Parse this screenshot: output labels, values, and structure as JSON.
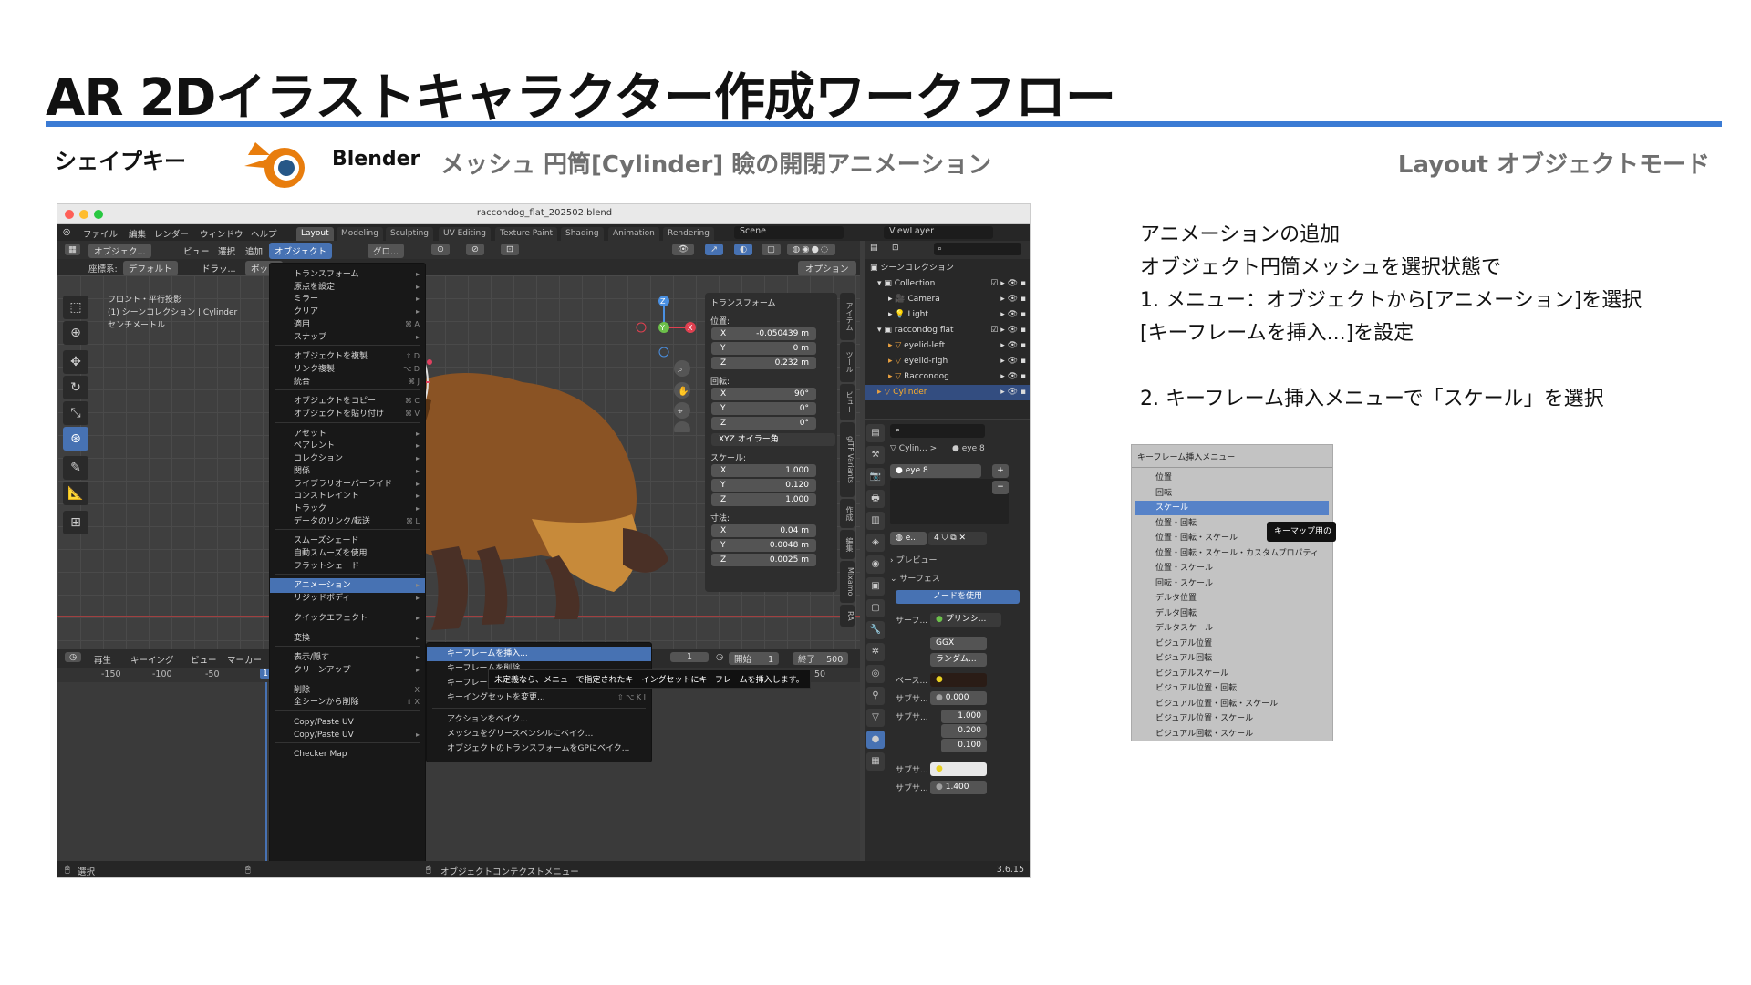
{
  "slide": {
    "title": "AR 2Dイラストキャラクター作成ワークフロー",
    "section": "シェイプキー",
    "app_name": "Blender",
    "subtitle": "メッシュ 円筒[Cylinder] 瞼の開閉アニメーション",
    "mode": "Layout オブジェクトモード",
    "accent_color": "#3b7bd4"
  },
  "instructions": [
    "アニメーションの追加",
    "オブジェクト円筒メッシュを選択状態で",
    "1. メニュー：オブジェクトから[アニメーション]を選択",
    "[キーフレームを挿入...]を設定",
    "",
    "2. キーフレーム挿入メニューで「スケール」を選択"
  ],
  "blender": {
    "file_name": "raccondog_flat_202502.blend",
    "menubar": [
      "ファイル",
      "編集",
      "レンダー",
      "ウィンドウ",
      "ヘルプ"
    ],
    "workspaces": [
      "Layout",
      "Modeling",
      "Sculpting",
      "UV Editing",
      "Texture Paint",
      "Shading",
      "Animation",
      "Rendering"
    ],
    "active_workspace": "Layout",
    "scene": "Scene",
    "view_layer": "ViewLayer",
    "header": {
      "mode": "オブジェク...",
      "view": "ビュー",
      "select": "選択",
      "add": "追加",
      "object": "オブジェクト",
      "transform_orientation": "グロ...",
      "coord_label": "座標系:",
      "coord_value": "デフォルト",
      "drag": "ドラッ...",
      "box": "ボック",
      "options": "オプション"
    },
    "viewport_overlay": [
      "フロント・平行投影",
      "(1) シーンコレクション | Cylinder",
      "センチメートル"
    ],
    "object_menu": [
      {
        "label": "トランスフォーム",
        "sub": true
      },
      {
        "label": "原点を設定",
        "sub": true
      },
      {
        "label": "ミラー",
        "sub": true
      },
      {
        "label": "クリア",
        "sub": true
      },
      {
        "label": "適用",
        "shortcut": "⌘ A"
      },
      {
        "label": "スナップ",
        "sub": true
      },
      {
        "sep": true
      },
      {
        "label": "オブジェクトを複製",
        "shortcut": "⇧ D"
      },
      {
        "label": "リンク複製",
        "shortcut": "⌥ D"
      },
      {
        "label": "統合",
        "shortcut": "⌘ J"
      },
      {
        "sep": true
      },
      {
        "label": "オブジェクトをコピー",
        "shortcut": "⌘ C"
      },
      {
        "label": "オブジェクトを貼り付け",
        "shortcut": "⌘ V"
      },
      {
        "sep": true
      },
      {
        "label": "アセット",
        "sub": true
      },
      {
        "label": "ペアレント",
        "sub": true
      },
      {
        "label": "コレクション",
        "sub": true
      },
      {
        "label": "関係",
        "sub": true
      },
      {
        "label": "ライブラリオーバーライド",
        "sub": true
      },
      {
        "label": "コンストレイント",
        "sub": true
      },
      {
        "label": "トラック",
        "sub": true
      },
      {
        "label": "データのリンク/転送",
        "shortcut": "⌘ L"
      },
      {
        "sep": true
      },
      {
        "label": "スムーズシェード"
      },
      {
        "label": "自動スムーズを使用"
      },
      {
        "label": "フラットシェード"
      },
      {
        "sep": true
      },
      {
        "label": "アニメーション",
        "sub": true,
        "highlight": true
      },
      {
        "label": "リジッドボディ",
        "sub": true
      },
      {
        "sep": true
      },
      {
        "label": "クイックエフェクト",
        "sub": true
      },
      {
        "sep": true
      },
      {
        "label": "変換",
        "sub": true
      },
      {
        "sep": true
      },
      {
        "label": "表示/隠す",
        "sub": true
      },
      {
        "label": "クリーンアップ",
        "sub": true
      },
      {
        "sep": true
      },
      {
        "label": "削除",
        "shortcut": "X"
      },
      {
        "label": "全シーンから削除",
        "shortcut": "⇧ X"
      },
      {
        "sep": true
      },
      {
        "label": "Copy/Paste UV"
      },
      {
        "label": "Copy/Paste UV",
        "sub": true
      },
      {
        "sep": true
      },
      {
        "label": "Checker Map"
      }
    ],
    "anim_submenu": [
      {
        "label": "キーフレームを挿入...",
        "highlight": true
      },
      {
        "label": "キーフレームを削除..."
      },
      {
        "label": "キーフレームを消去..."
      },
      {
        "label": "キーイングセットを変更...",
        "shortcut": "⇧ ⌥ K I"
      },
      {
        "sep": true
      },
      {
        "label": "アクションをベイク..."
      },
      {
        "label": "メッシュをグリースペンシルにベイク..."
      },
      {
        "label": "オブジェクトのトランスフォームをGPにベイク..."
      }
    ],
    "tooltip": "未定義なら、メニューで指定されたキーイングセットにキーフレームを挿入します。",
    "transform_panel": {
      "header": "トランスフォーム",
      "location_label": "位置:",
      "location": [
        {
          "axis": "X",
          "value": "-0.050439 m"
        },
        {
          "axis": "Y",
          "value": "0 m"
        },
        {
          "axis": "Z",
          "value": "0.232 m"
        }
      ],
      "rotation_label": "回転:",
      "rotation": [
        {
          "axis": "X",
          "value": "90°"
        },
        {
          "axis": "Y",
          "value": "0°"
        },
        {
          "axis": "Z",
          "value": "0°"
        }
      ],
      "rotation_mode": "XYZ オイラー角",
      "scale_label": "スケール:",
      "scale": [
        {
          "axis": "X",
          "value": "1.000"
        },
        {
          "axis": "Y",
          "value": "0.120"
        },
        {
          "axis": "Z",
          "value": "1.000"
        }
      ],
      "dimensions_label": "寸法:",
      "dimensions": [
        {
          "axis": "X",
          "value": "0.04 m"
        },
        {
          "axis": "Y",
          "value": "0.0048 m"
        },
        {
          "axis": "Z",
          "value": "0.0025 m"
        }
      ]
    },
    "sidebar_tabs": [
      "アイテム",
      "ツール",
      "ビュー",
      "glTF Variants",
      "作成",
      "編集",
      "Mixamo",
      "RA"
    ],
    "timeline": {
      "playback": "再生",
      "keying": "キーイング",
      "view": "ビュー",
      "marker": "マーカー",
      "current_frame": "1",
      "start_label": "開始",
      "start": "1",
      "end_label": "終了",
      "end": "500",
      "ruler": [
        "-150",
        "-100",
        "-50",
        "1",
        "50"
      ]
    },
    "outliner": {
      "root": "シーンコレクション",
      "items": [
        {
          "label": "Collection",
          "depth": 1
        },
        {
          "label": "Camera",
          "depth": 2
        },
        {
          "label": "Light",
          "depth": 2
        },
        {
          "label": "raccondog flat",
          "depth": 1
        },
        {
          "label": "eyelid-left",
          "depth": 2
        },
        {
          "label": "eyelid-righ",
          "depth": 2
        },
        {
          "label": "Raccondog",
          "depth": 2
        },
        {
          "label": "Cylinder",
          "depth": 1,
          "selected": true
        }
      ]
    },
    "properties": {
      "breadcrumb_obj": "Cylin...",
      "breadcrumb_mat": "eye 8",
      "material_slot": "eye 8",
      "mat_field": "e...",
      "users": "4",
      "preview": "プレビュー",
      "surface_header": "サーフェス",
      "use_nodes": "ノードを使用",
      "surface_label": "サーフ...",
      "surface_value": "プリンシ...",
      "distribution": "GGX",
      "subsurface_method": "ランダム...",
      "base_label": "ベース...",
      "sub1_label": "サブサ...",
      "sub1_value": "0.000",
      "sub2_label": "サブサ...",
      "radius": [
        "1.000",
        "0.200",
        "0.100"
      ],
      "sub3_label": "サブサ...",
      "sub4_label": "サブサ...",
      "sub4_value": "1.400"
    },
    "status": {
      "left": "選択",
      "mid": "オブジェクトコンテクストメニュー",
      "version": "3.6.15"
    }
  },
  "keyframe_menu": {
    "title": "キーフレーム挿入メニュー",
    "items": [
      "位置",
      "回転",
      "スケール",
      "位置・回転",
      "位置・回転・スケール",
      "位置・回転・スケール・カスタムプロパティ",
      "位置・スケール",
      "回転・スケール",
      "デルタ位置",
      "デルタ回転",
      "デルタスケール",
      "ビジュアル位置",
      "ビジュアル回転",
      "ビジュアルスケール",
      "ビジュアル位置・回転",
      "ビジュアル位置・回転・スケール",
      "ビジュアル位置・スケール",
      "ビジュアル回転・スケール"
    ],
    "selected_index": 2,
    "tooltip": "キーマップ用の"
  }
}
